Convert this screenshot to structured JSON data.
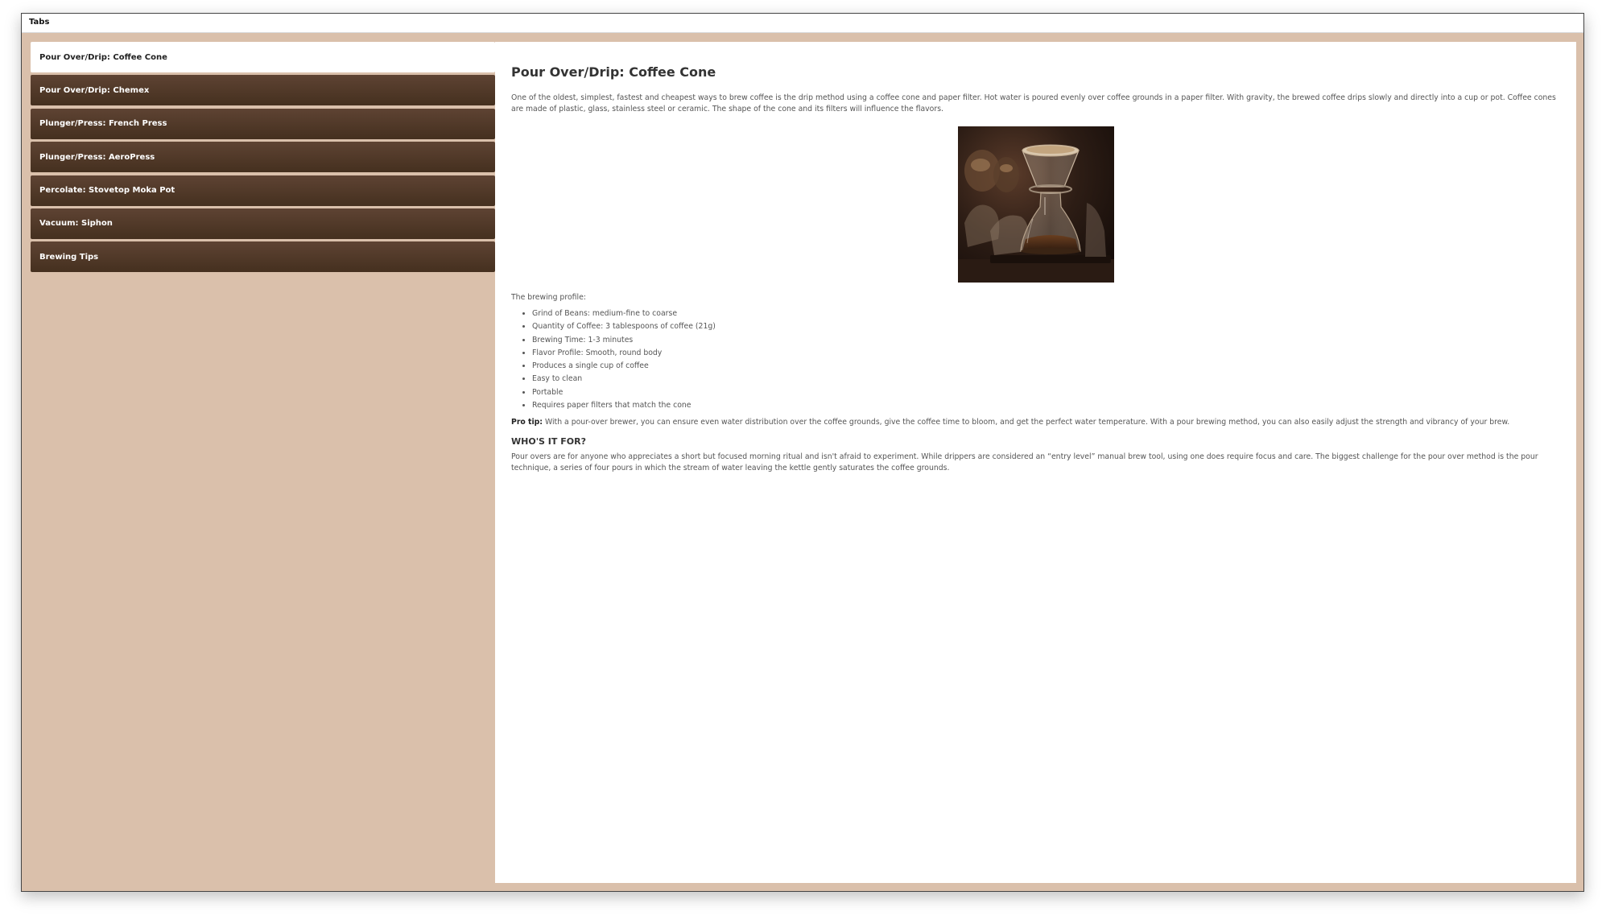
{
  "window": {
    "title": "Tabs"
  },
  "tabs": [
    {
      "label": "Pour Over/Drip: Coffee Cone",
      "active": true
    },
    {
      "label": "Pour Over/Drip: Chemex",
      "active": false
    },
    {
      "label": "Plunger/Press: French Press",
      "active": false
    },
    {
      "label": "Plunger/Press: AeroPress",
      "active": false
    },
    {
      "label": "Percolate: Stovetop Moka Pot",
      "active": false
    },
    {
      "label": "Vacuum: Siphon",
      "active": false
    },
    {
      "label": "Brewing Tips",
      "active": false
    }
  ],
  "content": {
    "heading": "Pour Over/Drip: Coffee Cone",
    "intro": "One of the oldest, simplest, fastest and cheapest ways to brew coffee is the drip method using a coffee cone and paper filter. Hot water is poured evenly over coffee grounds in a paper filter. With gravity, the brewed coffee drips slowly and directly into a cup or pot. Coffee cones are made of plastic, glass, stainless steel or ceramic. The shape of the cone and its filters will influence the flavors.",
    "image_icon": "coffee-cone-photo",
    "profile_label": "The brewing profile:",
    "profile_items": [
      "Grind of Beans: medium-fine to coarse",
      "Quantity of Coffee: 3 tablespoons of coffee (21g)",
      "Brewing Time: 1-3 minutes",
      "Flavor Profile: Smooth, round body",
      "Produces a single cup of coffee",
      "Easy to clean",
      "Portable",
      "Requires paper filters that match the cone"
    ],
    "pro_tip_label": "Pro tip:",
    "pro_tip_text": " With a pour-over brewer, you can ensure even water distribution over the coffee grounds, give the coffee time to bloom, and get the perfect water temperature. With a pour brewing method, you can also easily adjust the strength and vibrancy of your brew.",
    "whos_it_for_heading": "WHO'S IT FOR?",
    "whos_it_for_text": "Pour overs are for anyone who appreciates a short but focused morning ritual and isn't afraid to experiment. While drippers are considered an “entry level” manual brew tool, using one does require focus and care. The biggest challenge for the pour over method is the pour technique, a series of four pours in which the stream of water leaving the kettle gently saturates the coffee grounds."
  },
  "colors": {
    "page_background": "#dac0ab",
    "tab_background": "#55402f",
    "active_tab_background": "#ffffff"
  }
}
